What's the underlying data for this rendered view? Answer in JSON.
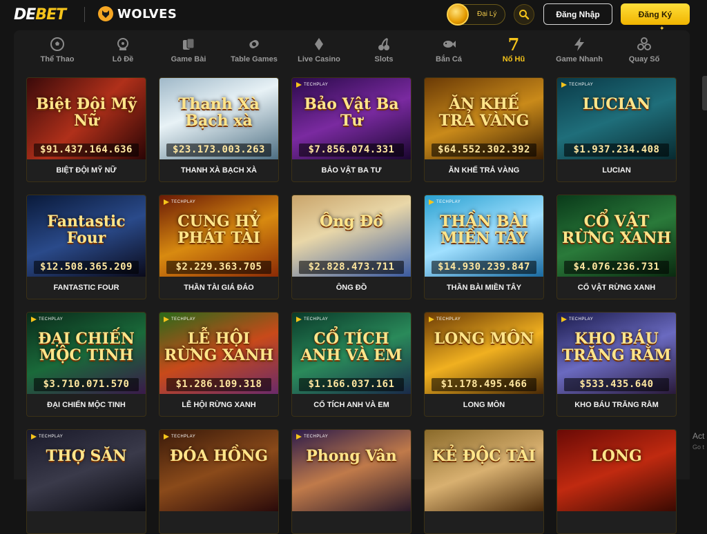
{
  "header": {
    "logo_main": "DE",
    "logo_accent": "BET",
    "partner_name": "WOLVES",
    "agent_label": "Đại Lý",
    "login_label": "Đăng Nhập",
    "register_label": "Đăng Ký"
  },
  "nav": {
    "items": [
      {
        "label": "Thể Thao",
        "icon": "soccer-ball-icon"
      },
      {
        "label": "Lô Đề",
        "icon": "lottery-wheel-icon"
      },
      {
        "label": "Game Bài",
        "icon": "cards-icon"
      },
      {
        "label": "Table Games",
        "icon": "chips-icon"
      },
      {
        "label": "Live Casino",
        "icon": "diamond-suit-icon"
      },
      {
        "label": "Slots",
        "icon": "cherry-icon"
      },
      {
        "label": "Bắn Cá",
        "icon": "fish-icon"
      },
      {
        "label": "Nổ Hũ",
        "icon": "seven-icon"
      },
      {
        "label": "Game Nhanh",
        "icon": "lightning-icon"
      },
      {
        "label": "Quay Số",
        "icon": "balls-icon"
      }
    ],
    "active_index": 7,
    "accent": "#f5c41b"
  },
  "games": [
    {
      "name": "BIỆT ĐỘI MỸ NỮ",
      "jackpot": "$91.437.164.636",
      "art": "Biệt Đội Mỹ Nữ",
      "techplay": false
    },
    {
      "name": "THANH XÀ BẠCH XÀ",
      "jackpot": "$23.173.003.263",
      "art": "Thanh Xà Bạch xà",
      "techplay": false
    },
    {
      "name": "BẢO VẬT BA TƯ",
      "jackpot": "$7.856.074.331",
      "art": "Bảo Vật Ba Tư",
      "techplay": true
    },
    {
      "name": "ĂN KHẾ TRẢ VÀNG",
      "jackpot": "$64.552.302.392",
      "art": "ĂN KHẾ TRẢ VÀNG",
      "techplay": false
    },
    {
      "name": "LUCIAN",
      "jackpot": "$1.937.234.408",
      "art": "LUCIAN",
      "techplay": true
    },
    {
      "name": "FANTASTIC FOUR",
      "jackpot": "$12.508.365.209",
      "art": "Fantastic Four",
      "techplay": false
    },
    {
      "name": "THẦN TÀI GIÁ ĐÁO",
      "jackpot": "$2.229.363.705",
      "art": "CUNG HỶ PHÁT TÀI",
      "techplay": true
    },
    {
      "name": "ÔNG ĐỒ",
      "jackpot": "$2.828.473.711",
      "art": "Ông Đồ",
      "techplay": false
    },
    {
      "name": "THẦN BÀI MIỀN TÂY",
      "jackpot": "$14.930.239.847",
      "art": "THẦN BÀI MIỀN TÂY",
      "techplay": true
    },
    {
      "name": "CỔ VẬT RỪNG XANH",
      "jackpot": "$4.076.236.731",
      "art": "CỔ VẬT RỪNG XANH",
      "techplay": false
    },
    {
      "name": "ĐẠI CHIẾN MỘC TINH",
      "jackpot": "$3.710.071.570",
      "art": "ĐẠI CHIẾN MỘC TINH",
      "techplay": true
    },
    {
      "name": "LỄ HỘI RỪNG XANH",
      "jackpot": "$1.286.109.318",
      "art": "LỄ HỘI RỪNG XANH",
      "techplay": true
    },
    {
      "name": "CỔ TÍCH ANH VÀ EM",
      "jackpot": "$1.166.037.161",
      "art": "CỔ TÍCH ANH VÀ EM",
      "techplay": true
    },
    {
      "name": "LONG MÔN",
      "jackpot": "$1.178.495.466",
      "art": "LONG MÔN",
      "techplay": true
    },
    {
      "name": "KHO BÁU TRĂNG RẰM",
      "jackpot": "$533.435.640",
      "art": "KHO BÁU TRĂNG RẰM",
      "techplay": true
    },
    {
      "name": "",
      "jackpot": "",
      "art": "THỢ SĂN",
      "techplay": true
    },
    {
      "name": "",
      "jackpot": "",
      "art": "ĐÓA HỒNG",
      "techplay": true
    },
    {
      "name": "",
      "jackpot": "",
      "art": "Phong Vân",
      "techplay": true
    },
    {
      "name": "",
      "jackpot": "",
      "art": "KẺ ĐỘC TÀI",
      "techplay": false
    },
    {
      "name": "",
      "jackpot": "",
      "art": "LONG",
      "techplay": false
    }
  ],
  "techplay_label": "TECHPLAY",
  "watermark": {
    "line1": "Act",
    "line2": "Go t"
  }
}
